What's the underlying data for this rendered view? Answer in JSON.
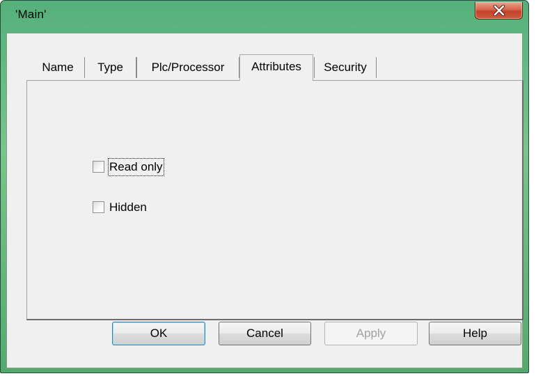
{
  "window": {
    "title": "'Main'",
    "close_icon": "close-icon"
  },
  "tabs": [
    {
      "label": "Name",
      "active": false
    },
    {
      "label": "Type",
      "active": false
    },
    {
      "label": "Plc/Processor",
      "active": false
    },
    {
      "label": "Attributes",
      "active": true
    },
    {
      "label": "Security",
      "active": false
    }
  ],
  "attributes": {
    "read_only": {
      "label": "Read only",
      "checked": false
    },
    "hidden": {
      "label": "Hidden",
      "checked": false
    }
  },
  "buttons": {
    "ok": "OK",
    "cancel": "Cancel",
    "apply": "Apply",
    "help": "Help"
  },
  "colors": {
    "title_bar": "#79c48a",
    "close_button": "#c2432a",
    "dialog_face": "#f0f0f0"
  }
}
